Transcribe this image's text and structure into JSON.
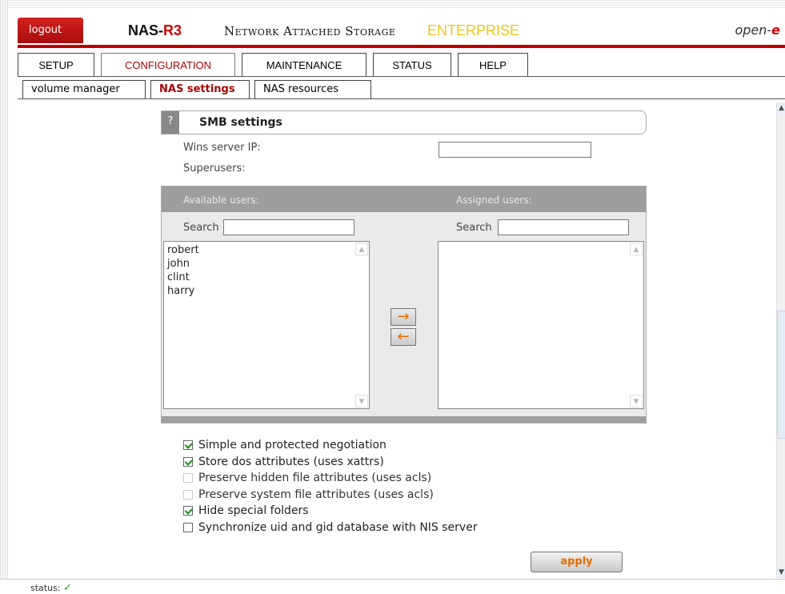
{
  "header": {
    "logout_label": "logout",
    "brand_main": "NAS-",
    "brand_r3": "R3",
    "subtitle": "Network Attached Storage",
    "edition": "ENTERPRISE",
    "vendor_logo": "open-",
    "vendor_logo_e": "e"
  },
  "main_tabs": [
    {
      "label": "SETUP",
      "active": false
    },
    {
      "label": "CONFIGURATION",
      "active": true
    },
    {
      "label": "MAINTENANCE",
      "active": false
    },
    {
      "label": "STATUS",
      "active": false
    },
    {
      "label": "HELP",
      "active": false
    }
  ],
  "sub_tabs": [
    {
      "label": "volume manager",
      "active": false
    },
    {
      "label": "NAS settings",
      "active": true
    },
    {
      "label": "NAS resources",
      "active": false
    }
  ],
  "section": {
    "help_label": "?",
    "title": "SMB settings"
  },
  "form": {
    "wins_label": "Wins server IP:",
    "wins_value": "",
    "superusers_label": "Superusers:"
  },
  "users": {
    "available_label": "Available users:",
    "assigned_label": "Assigned users:",
    "search_label_left": "Search",
    "search_label_right": "Search",
    "available_items": [
      "robert",
      "john",
      "clint",
      "harry"
    ],
    "assigned_items": [],
    "move_right_symbol": "→",
    "move_left_symbol": "←"
  },
  "options": [
    {
      "label": "Simple and protected negotiation",
      "checked": true,
      "enabled": true
    },
    {
      "label": "Store dos attributes (uses xattrs)",
      "checked": true,
      "enabled": true
    },
    {
      "label": "Preserve hidden file attributes (uses acls)",
      "checked": false,
      "enabled": false
    },
    {
      "label": "Preserve system file attributes (uses acls)",
      "checked": false,
      "enabled": false
    },
    {
      "label": "Hide special folders",
      "checked": true,
      "enabled": true
    },
    {
      "label": "Synchronize uid and gid database with NIS server",
      "checked": false,
      "enabled": true
    }
  ],
  "apply_label": "apply",
  "status": {
    "label": "status:",
    "icon": "checkmark-icon",
    "symbol": "✓",
    "color": "#1a9c1a"
  },
  "colors": {
    "accent_red": "#b00000",
    "edition_yellow": "#f0c419",
    "button_orange": "#e56b00"
  }
}
